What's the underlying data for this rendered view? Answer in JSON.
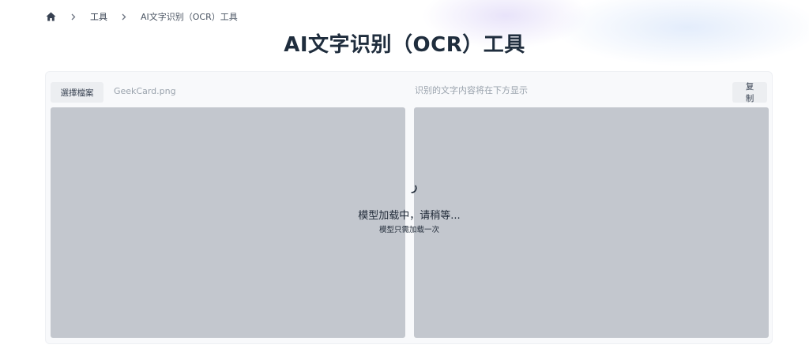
{
  "breadcrumb": {
    "home_icon": "home-icon",
    "separator_icon": "chevron-right-icon",
    "items": [
      {
        "label": "工具"
      },
      {
        "label": "AI文字识别（OCR）工具"
      }
    ]
  },
  "page_title": "AI文字识别（OCR）工具",
  "toolbar": {
    "choose_file_label": "選擇檔案",
    "file_name": "GeekCard.png",
    "output_hint": "识别的文字内容将在下方显示",
    "copy_label": "复制"
  },
  "loading": {
    "spinner_icon": "spinner-icon",
    "message": "模型加载中，请稍等...",
    "note": "模型只需加载一次"
  },
  "colors": {
    "pane_background": "#c3c7ce",
    "panel_background": "#f8f9fb",
    "button_background": "#eceef1",
    "title_color": "#1f2d3d"
  }
}
